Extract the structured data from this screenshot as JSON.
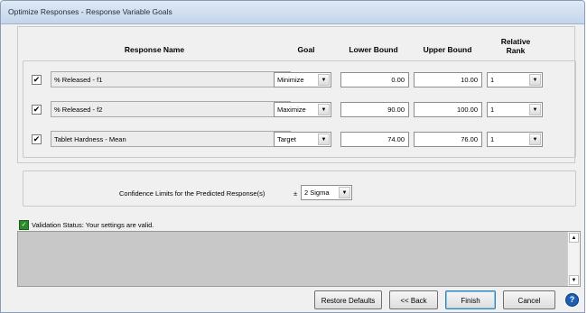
{
  "window": {
    "title": "Optimize Responses - Response Variable Goals"
  },
  "headers": {
    "response_name": "Response Name",
    "goal": "Goal",
    "lower_bound": "Lower Bound",
    "upper_bound": "Upper Bound",
    "relative_rank": "Relative Rank"
  },
  "rows": [
    {
      "checked": "✔",
      "name": "% Released - f1",
      "goal": "Minimize",
      "lower": "0.00",
      "upper": "10.00",
      "rank": "1"
    },
    {
      "checked": "✔",
      "name": "% Released - f2",
      "goal": "Maximize",
      "lower": "90.00",
      "upper": "100.00",
      "rank": "1"
    },
    {
      "checked": "✔",
      "name": "Tablet Hardness - Mean",
      "goal": "Target",
      "lower": "74.00",
      "upper": "76.00",
      "rank": "1"
    }
  ],
  "confidence": {
    "label": "Confidence Limits for the Predicted Response(s)",
    "pm": "±",
    "value": "2 Sigma"
  },
  "validation": {
    "icon": "validation-ok-icon",
    "text": "Validation Status: Your settings are valid."
  },
  "buttons": {
    "restore": "Restore Defaults",
    "back": "<< Back",
    "finish": "Finish",
    "cancel": "Cancel",
    "help": "?"
  },
  "glyphs": {
    "dropdown": "▼",
    "scroll_up": "▲",
    "scroll_down": "▼"
  }
}
